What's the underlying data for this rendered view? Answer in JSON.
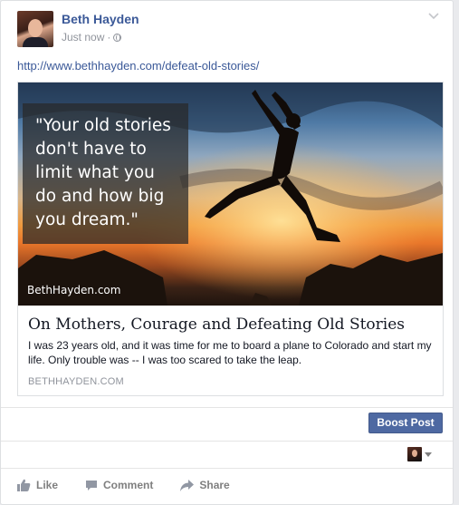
{
  "post": {
    "author_name": "Beth Hayden",
    "timestamp": "Just now",
    "separator": "·",
    "audience_icon": "globe-icon",
    "link_url": "http://www.bethhayden.com/defeat-old-stories/"
  },
  "share": {
    "quote_lines": [
      "\"Your old stories",
      "don't have to",
      "limit what you",
      "do and how big",
      "you dream.\""
    ],
    "watermark": "BethHayden.com",
    "title": "On Mothers, Courage and Defeating Old Stories",
    "description": "I was 23 years old, and it was time for me to board a plane to Colorado and start my life. Only trouble was -- I was too scared to take the leap.",
    "domain": "BETHHAYDEN.COM"
  },
  "boost": {
    "label": "Boost Post"
  },
  "actions": {
    "like": "Like",
    "comment": "Comment",
    "share": "Share"
  },
  "colors": {
    "link": "#3b5998",
    "boost_button": "#4e69a2",
    "muted": "#90949c"
  }
}
